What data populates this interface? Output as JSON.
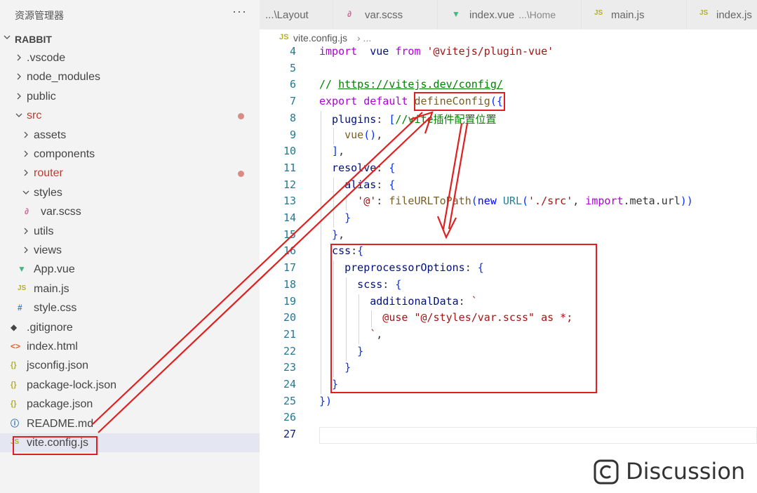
{
  "explorer": {
    "title": "资源管理器",
    "more": "···",
    "project": "RABBIT"
  },
  "tree": [
    {
      "label": ".vscode",
      "kind": "folder",
      "level": 0,
      "expanded": false
    },
    {
      "label": "node_modules",
      "kind": "folder",
      "level": 0,
      "expanded": false
    },
    {
      "label": "public",
      "kind": "folder",
      "level": 0,
      "expanded": false
    },
    {
      "label": "src",
      "kind": "folder",
      "level": 0,
      "expanded": true,
      "modified": true
    },
    {
      "label": "assets",
      "kind": "folder",
      "level": 1,
      "expanded": false
    },
    {
      "label": "components",
      "kind": "folder",
      "level": 1,
      "expanded": false
    },
    {
      "label": "router",
      "kind": "folder",
      "level": 1,
      "expanded": false,
      "modified": true
    },
    {
      "label": "styles",
      "kind": "folder",
      "level": 1,
      "expanded": true
    },
    {
      "label": "var.scss",
      "kind": "scss",
      "level": 2
    },
    {
      "label": "utils",
      "kind": "folder",
      "level": 1,
      "expanded": false
    },
    {
      "label": "views",
      "kind": "folder",
      "level": 1,
      "expanded": false
    },
    {
      "label": "App.vue",
      "kind": "vue",
      "level": 1
    },
    {
      "label": "main.js",
      "kind": "js",
      "level": 1
    },
    {
      "label": "style.css",
      "kind": "css",
      "level": 1
    },
    {
      "label": ".gitignore",
      "kind": "git",
      "level": 0
    },
    {
      "label": "index.html",
      "kind": "html",
      "level": 0
    },
    {
      "label": "jsconfig.json",
      "kind": "json",
      "level": 0
    },
    {
      "label": "package-lock.json",
      "kind": "json",
      "level": 0
    },
    {
      "label": "package.json",
      "kind": "json",
      "level": 0
    },
    {
      "label": "README.md",
      "kind": "info",
      "level": 0
    },
    {
      "label": "vite.config.js",
      "kind": "js",
      "level": 0,
      "selected": true
    }
  ],
  "tabs": [
    {
      "label": "...\\Layout",
      "kind": "none"
    },
    {
      "label": "var.scss",
      "kind": "scss"
    },
    {
      "label": "index.vue",
      "sub": "...\\Home",
      "kind": "vue"
    },
    {
      "label": "main.js",
      "kind": "js"
    },
    {
      "label": "index.js",
      "kind": "js"
    }
  ],
  "breadcrumb": {
    "icon": "JS",
    "file": "vite.config.js",
    "sep": "› ..."
  },
  "editor": {
    "current_line": 27,
    "lines": [
      {
        "n": 4,
        "indent": 0,
        "tokens": [
          [
            "kw2",
            "import"
          ],
          [
            "",
            "  "
          ],
          [
            "pr",
            "vue"
          ],
          [
            "",
            " "
          ],
          [
            "kw2",
            "from"
          ],
          [
            "",
            " "
          ],
          [
            "st",
            "'@vitejs/plugin-vue'"
          ]
        ]
      },
      {
        "n": 5,
        "indent": 0,
        "tokens": []
      },
      {
        "n": 6,
        "indent": 0,
        "tokens": [
          [
            "cm",
            "// "
          ],
          [
            "lk",
            "https://vitejs.dev/config/"
          ]
        ]
      },
      {
        "n": 7,
        "indent": 0,
        "tokens": [
          [
            "kw2",
            "export"
          ],
          [
            "",
            " "
          ],
          [
            "kw2",
            "default"
          ],
          [
            "",
            " "
          ],
          [
            "fn",
            "defineConfig"
          ],
          [
            "pn",
            "({"
          ]
        ]
      },
      {
        "n": 8,
        "indent": 1,
        "tokens": [
          [
            "pr",
            "plugins"
          ],
          [
            "",
            ": "
          ],
          [
            "pn",
            "["
          ],
          [
            "cm",
            "//vite插件配置位置"
          ]
        ]
      },
      {
        "n": 9,
        "indent": 2,
        "tokens": [
          [
            "fn",
            "vue"
          ],
          [
            "pn",
            "()"
          ],
          [
            "",
            ","
          ]
        ]
      },
      {
        "n": 10,
        "indent": 1,
        "tokens": [
          [
            "pn",
            "]"
          ],
          [
            "",
            ","
          ]
        ]
      },
      {
        "n": 11,
        "indent": 1,
        "tokens": [
          [
            "pr",
            "resolve"
          ],
          [
            "",
            ": "
          ],
          [
            "pn",
            "{"
          ]
        ]
      },
      {
        "n": 12,
        "indent": 2,
        "tokens": [
          [
            "pr",
            "alias"
          ],
          [
            "",
            ": "
          ],
          [
            "pn",
            "{"
          ]
        ]
      },
      {
        "n": 13,
        "indent": 3,
        "tokens": [
          [
            "st",
            "'@'"
          ],
          [
            "",
            ": "
          ],
          [
            "fn",
            "fileURLToPath"
          ],
          [
            "pn",
            "("
          ],
          [
            "kw",
            "new"
          ],
          [
            "",
            " "
          ],
          [
            "cl",
            "URL"
          ],
          [
            "pn",
            "("
          ],
          [
            "st",
            "'./src'"
          ],
          [
            "",
            ", "
          ],
          [
            "kw2",
            "import"
          ],
          [
            "",
            ".meta.url"
          ],
          [
            "pn",
            "))"
          ]
        ]
      },
      {
        "n": 14,
        "indent": 2,
        "tokens": [
          [
            "pn",
            "}"
          ]
        ]
      },
      {
        "n": 15,
        "indent": 1,
        "tokens": [
          [
            "pn",
            "}"
          ],
          [
            "",
            ","
          ]
        ]
      },
      {
        "n": 16,
        "indent": 1,
        "tokens": [
          [
            "pr",
            "css"
          ],
          [
            "",
            ":"
          ],
          [
            "pn",
            "{"
          ]
        ]
      },
      {
        "n": 17,
        "indent": 2,
        "tokens": [
          [
            "pr",
            "preprocessorOptions"
          ],
          [
            "",
            ": "
          ],
          [
            "pn",
            "{"
          ]
        ]
      },
      {
        "n": 18,
        "indent": 3,
        "tokens": [
          [
            "pr",
            "scss"
          ],
          [
            "",
            ": "
          ],
          [
            "pn",
            "{"
          ]
        ]
      },
      {
        "n": 19,
        "indent": 4,
        "tokens": [
          [
            "pr",
            "additionalData"
          ],
          [
            "",
            ": "
          ],
          [
            "st",
            "`"
          ]
        ]
      },
      {
        "n": 20,
        "indent": 5,
        "tokens": [
          [
            "st",
            "@use \"@/styles/var.scss\" as *;"
          ]
        ]
      },
      {
        "n": 21,
        "indent": 4,
        "tokens": [
          [
            "st",
            "`"
          ],
          [
            "",
            ","
          ]
        ]
      },
      {
        "n": 22,
        "indent": 3,
        "tokens": [
          [
            "pn",
            "}"
          ]
        ]
      },
      {
        "n": 23,
        "indent": 2,
        "tokens": [
          [
            "pn",
            "}"
          ]
        ]
      },
      {
        "n": 24,
        "indent": 1,
        "tokens": [
          [
            "pn",
            "}"
          ]
        ]
      },
      {
        "n": 25,
        "indent": 0,
        "tokens": [
          [
            "pn",
            "})"
          ]
        ]
      },
      {
        "n": 26,
        "indent": 0,
        "tokens": []
      },
      {
        "n": 27,
        "indent": 0,
        "tokens": []
      }
    ]
  },
  "watermark": {
    "text": "Discussion"
  },
  "colors": {
    "annotation": "#e02020",
    "accent_js": "#b5b020",
    "vue": "#41b883"
  }
}
